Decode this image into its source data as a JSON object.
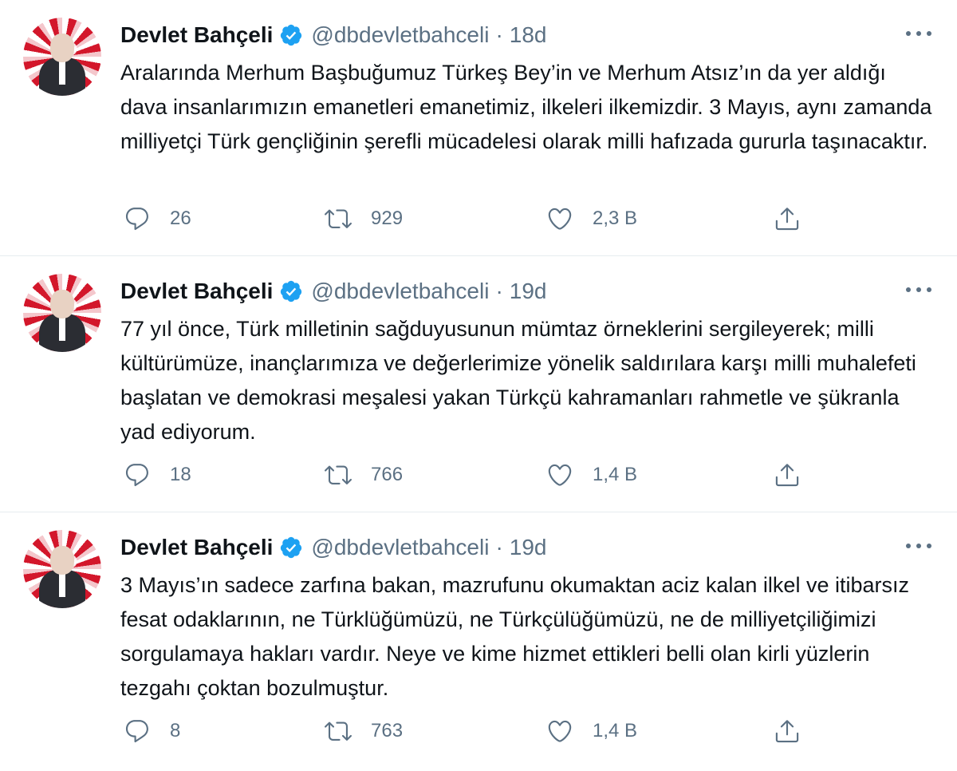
{
  "tweets": [
    {
      "author_name": "Devlet Bahçeli",
      "handle": "@dbdevletbahceli",
      "separator": "·",
      "time": "18d",
      "text": "Aralarında Merhum Başbuğumuz Türkeş Bey’in ve Merhum Atsız’ın da yer aldığı dava insanlarımızın emanetleri emanetimiz, ilkeleri ilkemizdir. 3 Mayıs, aynı zamanda milliyetçi Türk gençliğinin şerefli mücadelesi olarak milli hafızada gururla taşınacaktır.",
      "replies": "26",
      "retweets": "929",
      "likes": "2,3 B"
    },
    {
      "author_name": "Devlet Bahçeli",
      "handle": "@dbdevletbahceli",
      "separator": "·",
      "time": "19d",
      "text": "77 yıl önce, Türk milletinin sağduyusunun mümtaz örneklerini sergileyerek; milli kültürümüze, inançlarımıza ve değerlerimize yönelik saldırılara karşı milli muhalefeti başlatan ve demokrasi meşalesi yakan Türkçü kahramanları rahmetle ve şükranla yad ediyorum.",
      "replies": "18",
      "retweets": "766",
      "likes": "1,4 B"
    },
    {
      "author_name": "Devlet Bahçeli",
      "handle": "@dbdevletbahceli",
      "separator": "·",
      "time": "19d",
      "text": "3 Mayıs’ın sadece zarfına bakan, mazrufunu okumaktan aciz kalan ilkel ve itibarsız fesat odaklarının, ne Türklüğümüzü, ne Türkçülüğümüzü, ne de milliyetçiliğimizi sorgulamaya hakları vardır. Neye ve kime hizmet ettikleri belli olan kirli yüzlerin tezgahı çoktan bozulmuştur.",
      "replies": "8",
      "retweets": "763",
      "likes": "1,4 B"
    }
  ],
  "icons": {
    "verified": "verified-badge-icon",
    "more": "more-options-icon",
    "reply": "reply-icon",
    "retweet": "retweet-icon",
    "like": "like-icon",
    "share": "share-icon"
  },
  "colors": {
    "verified": "#1da1f2",
    "secondary_text": "#5b7083",
    "divider": "#e6ecf0"
  }
}
